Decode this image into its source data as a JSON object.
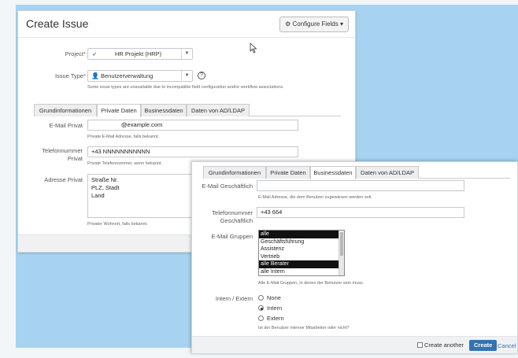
{
  "dialog1": {
    "title": "Create Issue",
    "configure_fields": "Configure Fields",
    "project_label": "Project",
    "project_value": "HR Projekt (HRP)",
    "issue_type_label": "Issue Type",
    "issue_type_value": "Benutzerverwaltung",
    "issue_type_note": "Some issue types are unavailable due to incompatible field configuration and/or workflow associations.",
    "tabs": [
      "Grundinformationen",
      "Private Daten",
      "Businessdaten",
      "Daten von AD/LDAP"
    ],
    "active_tab": "Private Daten",
    "email_label": "E-Mail Privat",
    "email_value": "@example.com",
    "email_note": "Private E-Mail Adresse, falls bekannt.",
    "phone_label_1": "Telefonnummer",
    "phone_label_2": "Privat",
    "phone_value": "+43 NNNNNNNNNNN",
    "phone_note": "Private Telefonnummer, wenn bekannt.",
    "address_label": "Adresse Privat",
    "address_lines": [
      "Straße Nr.",
      "PLZ, Stadt",
      "Land"
    ],
    "address_note": "Privater Wohnort, falls bekannt."
  },
  "dialog2": {
    "tabs": [
      "Grundinformationen",
      "Private Daten",
      "Businessdaten",
      "Daten von AD/LDAP"
    ],
    "active_tab": "Businessdaten",
    "email_label": "E-Mail Geschäftlich",
    "email_note": "E-Mail Adresse, die dem Benutzer zugewiesen werden soll.",
    "phone_label_1": "Telefonnummer",
    "phone_label_2": "Geschäftlich",
    "phone_value": "+43 664",
    "groups_label": "E-Mail Gruppen",
    "groups_options": [
      "alle",
      "Geschäftsführung",
      "Assistenz",
      "Vertrieb",
      "alle Berater",
      "alle Intern"
    ],
    "groups_selected": [
      "alle",
      "alle Berater"
    ],
    "groups_note": "Alle E-Mail Gruppen, in denen der Benutzer sein muss.",
    "intern_label": "Intern / Extern",
    "radio_options": [
      "None",
      "Intern",
      "Extern"
    ],
    "radio_selected": "Intern",
    "intern_note": "Ist der Benutzer interner Mitarbeiter oder nicht?",
    "create_another": "Create another",
    "create_button": "Create",
    "cancel_link": "Cancel"
  },
  "colors": {
    "accent": "#3572b0",
    "backdrop_blue": "#a8d3f0",
    "required": "#d04437"
  },
  "icons": [
    "gear-icon",
    "chevron-down-icon",
    "help-icon",
    "user-icon",
    "project-icon",
    "mouse-cursor-icon"
  ]
}
